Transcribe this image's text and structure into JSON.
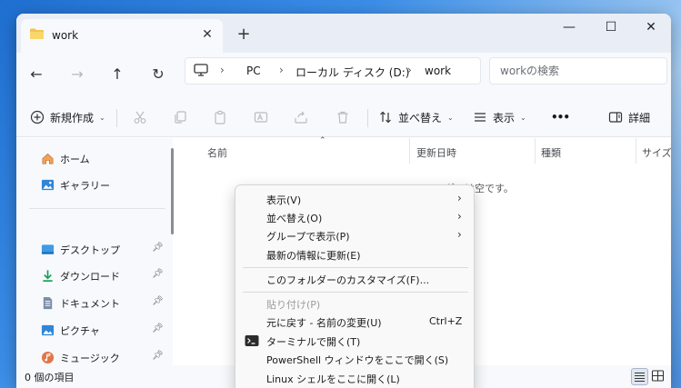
{
  "colors": {
    "accent": "#0067c0",
    "folder": "#f2c44e"
  },
  "tab": {
    "title": "work",
    "close_icon": "close-icon"
  },
  "window_controls": {
    "minimize": "—",
    "maximize": "☐",
    "close": "✕"
  },
  "nav": {
    "back": "←",
    "forward": "→",
    "up": "↑",
    "refresh": "↻"
  },
  "breadcrumb": {
    "items": [
      "PC",
      "ローカル ディスク (D:)",
      "work"
    ],
    "separator": "›"
  },
  "search": {
    "placeholder": "workの検索"
  },
  "toolbar": {
    "new_label": "新規作成",
    "sort_label": "並べ替え",
    "view_label": "表示",
    "more_label": "•••",
    "details_label": "詳細"
  },
  "sidebar": {
    "items": [
      {
        "label": "ホーム",
        "icon": "home-icon"
      },
      {
        "label": "ギャラリー",
        "icon": "gallery-icon"
      },
      {
        "label": "デスクトップ",
        "icon": "desktop-icon",
        "pinned": true
      },
      {
        "label": "ダウンロード",
        "icon": "download-icon",
        "pinned": true
      },
      {
        "label": "ドキュメント",
        "icon": "document-icon",
        "pinned": true
      },
      {
        "label": "ピクチャ",
        "icon": "pictures-icon",
        "pinned": true
      },
      {
        "label": "ミュージック",
        "icon": "music-icon",
        "pinned": true
      }
    ]
  },
  "columns": [
    "名前",
    "更新日時",
    "種類",
    "サイズ"
  ],
  "empty_message": "このフォルダーは空です。",
  "status": {
    "item_count": "0 個の項目"
  },
  "context_menu": {
    "items": [
      {
        "label": "表示(V)",
        "submenu": true
      },
      {
        "label": "並べ替え(O)",
        "submenu": true
      },
      {
        "label": "グループで表示(P)",
        "submenu": true
      },
      {
        "label": "最新の情報に更新(E)"
      },
      {
        "label": "このフォルダーのカスタマイズ(F)..."
      },
      {
        "label": "貼り付け(P)",
        "disabled": true
      },
      {
        "label": "元に戻す - 名前の変更(U)",
        "shortcut": "Ctrl+Z"
      },
      {
        "label": "ターミナルで開く(T)",
        "icon": "terminal-icon"
      },
      {
        "label": "PowerShell ウィンドウをここで開く(S)"
      },
      {
        "label": "Linux シェルをここに開く(L)"
      }
    ]
  }
}
